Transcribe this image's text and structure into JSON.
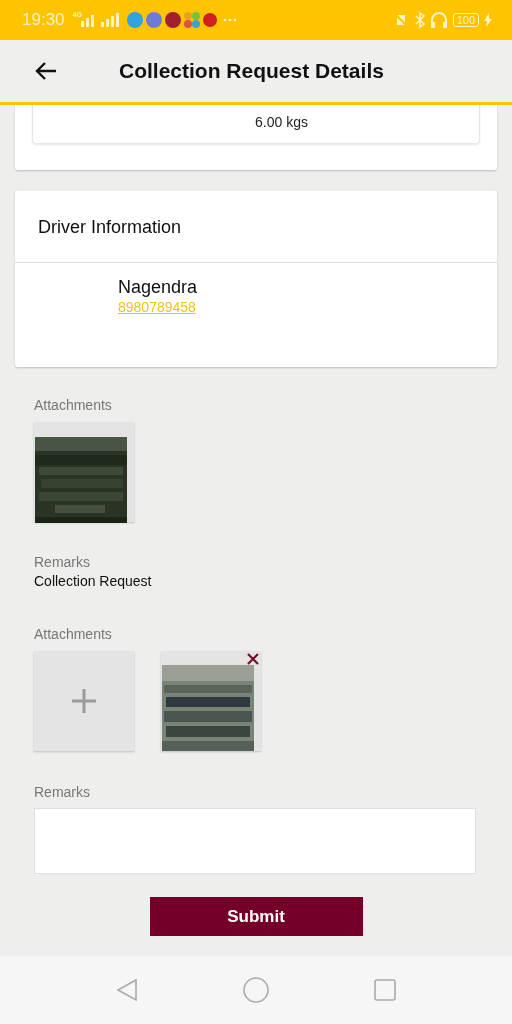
{
  "status_bar": {
    "time": "19:30",
    "network": "4G",
    "battery": "100"
  },
  "header": {
    "title": "Collection Request Details"
  },
  "weight_card": {
    "right_value": "6.00 kgs"
  },
  "driver_card": {
    "title": "Driver Information",
    "name": "Nagendra",
    "phone": "8980789458"
  },
  "existing": {
    "attachments_label": "Attachments",
    "attachments": [
      {
        "kind": "picture"
      }
    ],
    "remarks_label": "Remarks",
    "remarks": "Collection Request"
  },
  "new": {
    "attachments_label": "Attachments",
    "attachments": [
      {
        "kind": "add"
      },
      {
        "kind": "picture"
      }
    ],
    "remarks_label": "Remarks"
  },
  "submit": "Submit"
}
